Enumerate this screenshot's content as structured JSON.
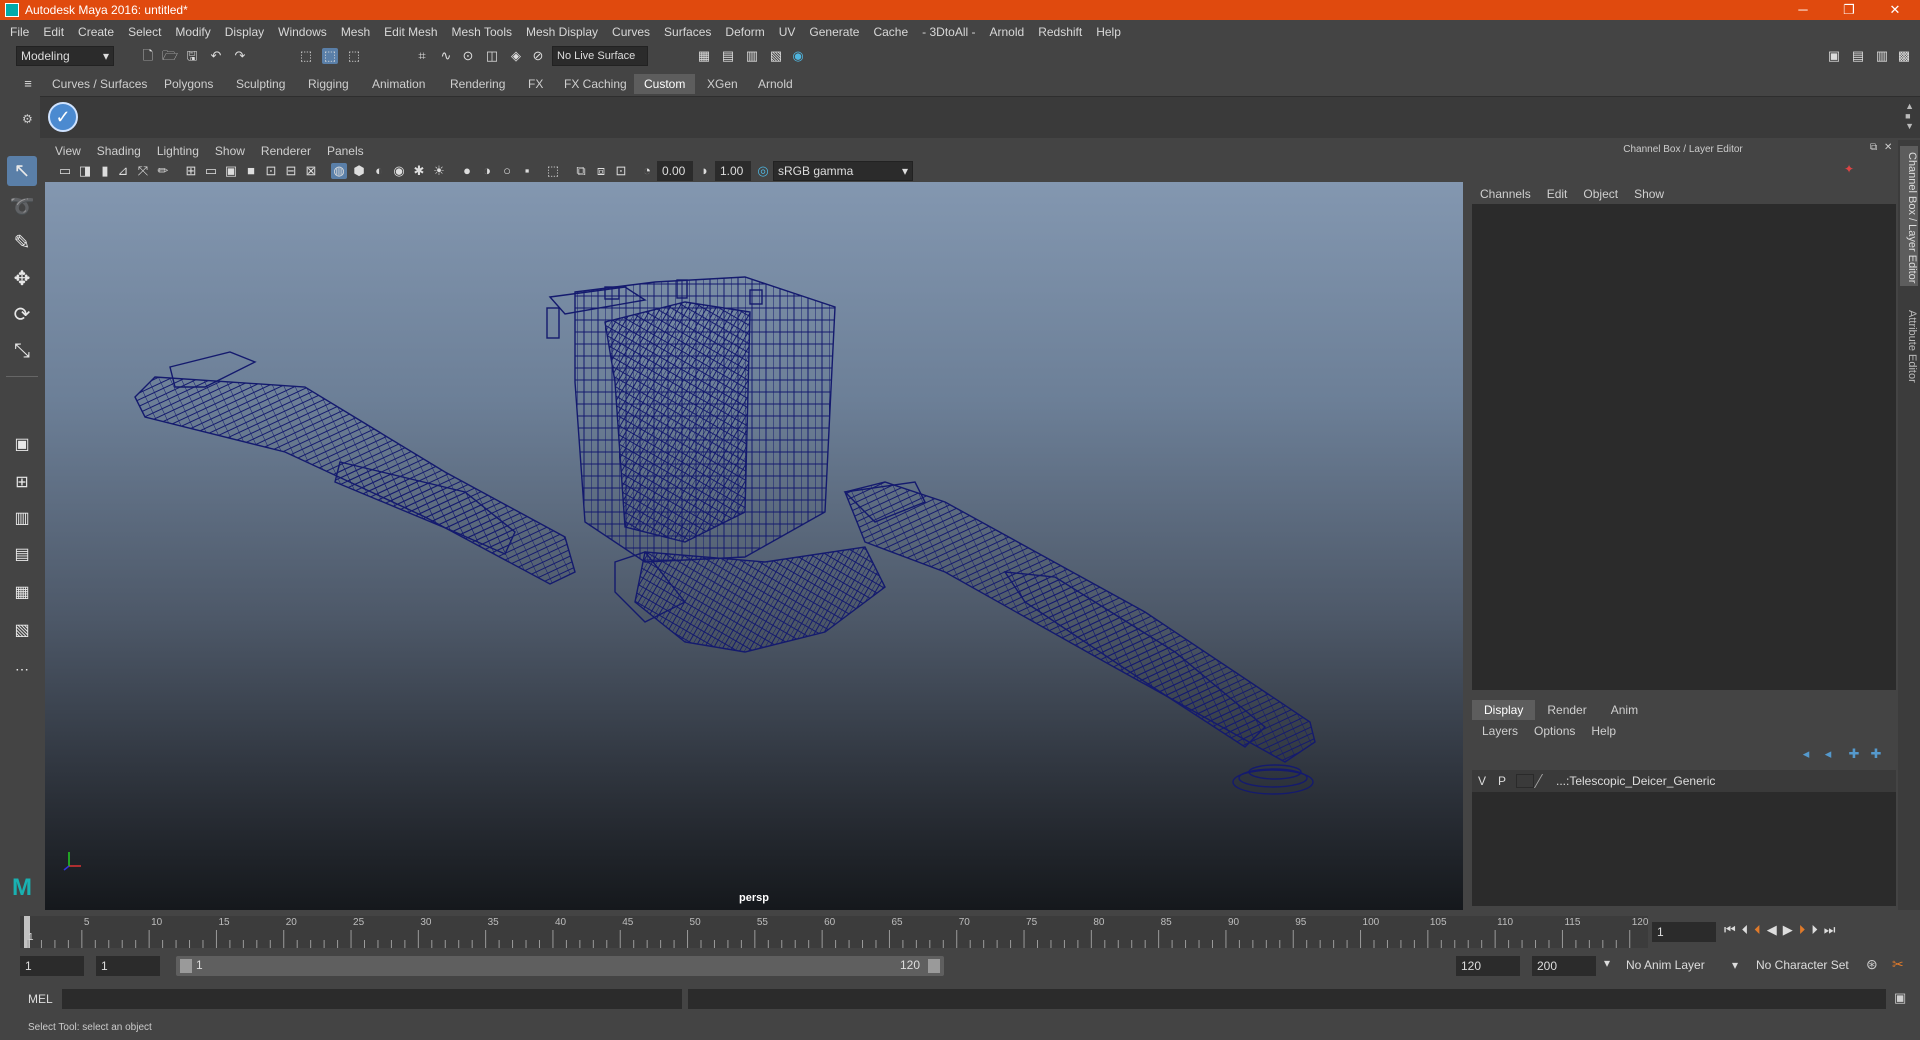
{
  "window": {
    "title": "Autodesk Maya 2016: untitled*",
    "min": "─",
    "max": "❐",
    "close": "✕"
  },
  "menu": [
    "File",
    "Edit",
    "Create",
    "Select",
    "Modify",
    "Display",
    "Windows",
    "Mesh",
    "Edit Mesh",
    "Mesh Tools",
    "Mesh Display",
    "Curves",
    "Surfaces",
    "Deform",
    "UV",
    "Generate",
    "Cache",
    "- 3DtoAll -",
    "Arnold",
    "Redshift",
    "Help"
  ],
  "status": {
    "mode": "Modeling",
    "live_surface": "No Live Surface"
  },
  "shelf_tabs": [
    "Curves / Surfaces",
    "Polygons",
    "Sculpting",
    "Rigging",
    "Animation",
    "Rendering",
    "FX",
    "FX Caching",
    "Custom",
    "XGen",
    "Arnold"
  ],
  "viewport": {
    "menu": [
      "View",
      "Shading",
      "Lighting",
      "Show",
      "Renderer",
      "Panels"
    ],
    "exposure": "0.00",
    "gamma": "1.00",
    "color_space": "sRGB gamma",
    "camera": "persp"
  },
  "channel_box": {
    "header": "Channel Box / Layer Editor",
    "menu": [
      "Channels",
      "Edit",
      "Object",
      "Show"
    ]
  },
  "layer_editor": {
    "tabs": [
      "Display",
      "Render",
      "Anim"
    ],
    "menu": [
      "Layers",
      "Options",
      "Help"
    ],
    "layer": {
      "v": "V",
      "p": "P",
      "name": "...:Telescopic_Deicer_Generic"
    }
  },
  "side_tabs": [
    "Channel Box / Layer Editor",
    "Attribute Editor"
  ],
  "timeline": {
    "ticks": [
      "5",
      "10",
      "15",
      "20",
      "25",
      "30",
      "35",
      "40",
      "45",
      "50",
      "55",
      "60",
      "65",
      "70",
      "75",
      "80",
      "85",
      "90",
      "95",
      "100",
      "105",
      "110",
      "115",
      "120"
    ],
    "start_label": "1",
    "current_frame": "1"
  },
  "range": {
    "start": "1",
    "playback_start": "1",
    "slider_start": "1",
    "slider_end": "120",
    "playback_end": "120",
    "end": "200",
    "anim_layer": "No Anim Layer",
    "character_set": "No Character Set"
  },
  "command": {
    "label": "MEL"
  },
  "help_line": "Select Tool: select an object",
  "colors": {
    "titlebar": "#e04a0e",
    "wire": "#141a6e",
    "accent": "#5a7fa8"
  }
}
